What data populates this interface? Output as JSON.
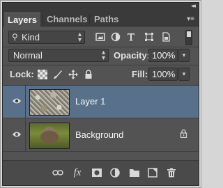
{
  "tabs": [
    {
      "label": "Layers",
      "active": true
    },
    {
      "label": "Channels",
      "active": false
    },
    {
      "label": "Paths",
      "active": false
    }
  ],
  "filter": {
    "kind_label": "Kind",
    "icons": [
      "pixel-filter-icon",
      "adjustment-filter-icon",
      "type-filter-icon",
      "shape-filter-icon",
      "smart-object-filter-icon"
    ]
  },
  "blend": {
    "mode": "Normal",
    "opacity_label": "Opacity:",
    "opacity_value": "100%",
    "fill_label": "Fill:",
    "fill_value": "100%"
  },
  "lock": {
    "label": "Lock:",
    "icons": [
      "lock-transparent-pixels-icon",
      "lock-image-pixels-icon",
      "lock-position-icon",
      "lock-all-icon"
    ]
  },
  "layers": [
    {
      "name": "Layer 1",
      "selected": true,
      "visible": true,
      "locked": false
    },
    {
      "name": "Background",
      "selected": false,
      "visible": true,
      "locked": true
    }
  ],
  "bottom_icons": [
    "link-layers-icon",
    "layer-style-icon",
    "layer-mask-icon",
    "adjustment-layer-icon",
    "new-group-icon",
    "new-layer-icon",
    "delete-layer-icon"
  ],
  "bottom_labels": {
    "fx": "fx"
  },
  "colors": {
    "panel_bg": "#535353",
    "tab_bar_bg": "#3a3a3a",
    "selected_row": "#58708a"
  }
}
